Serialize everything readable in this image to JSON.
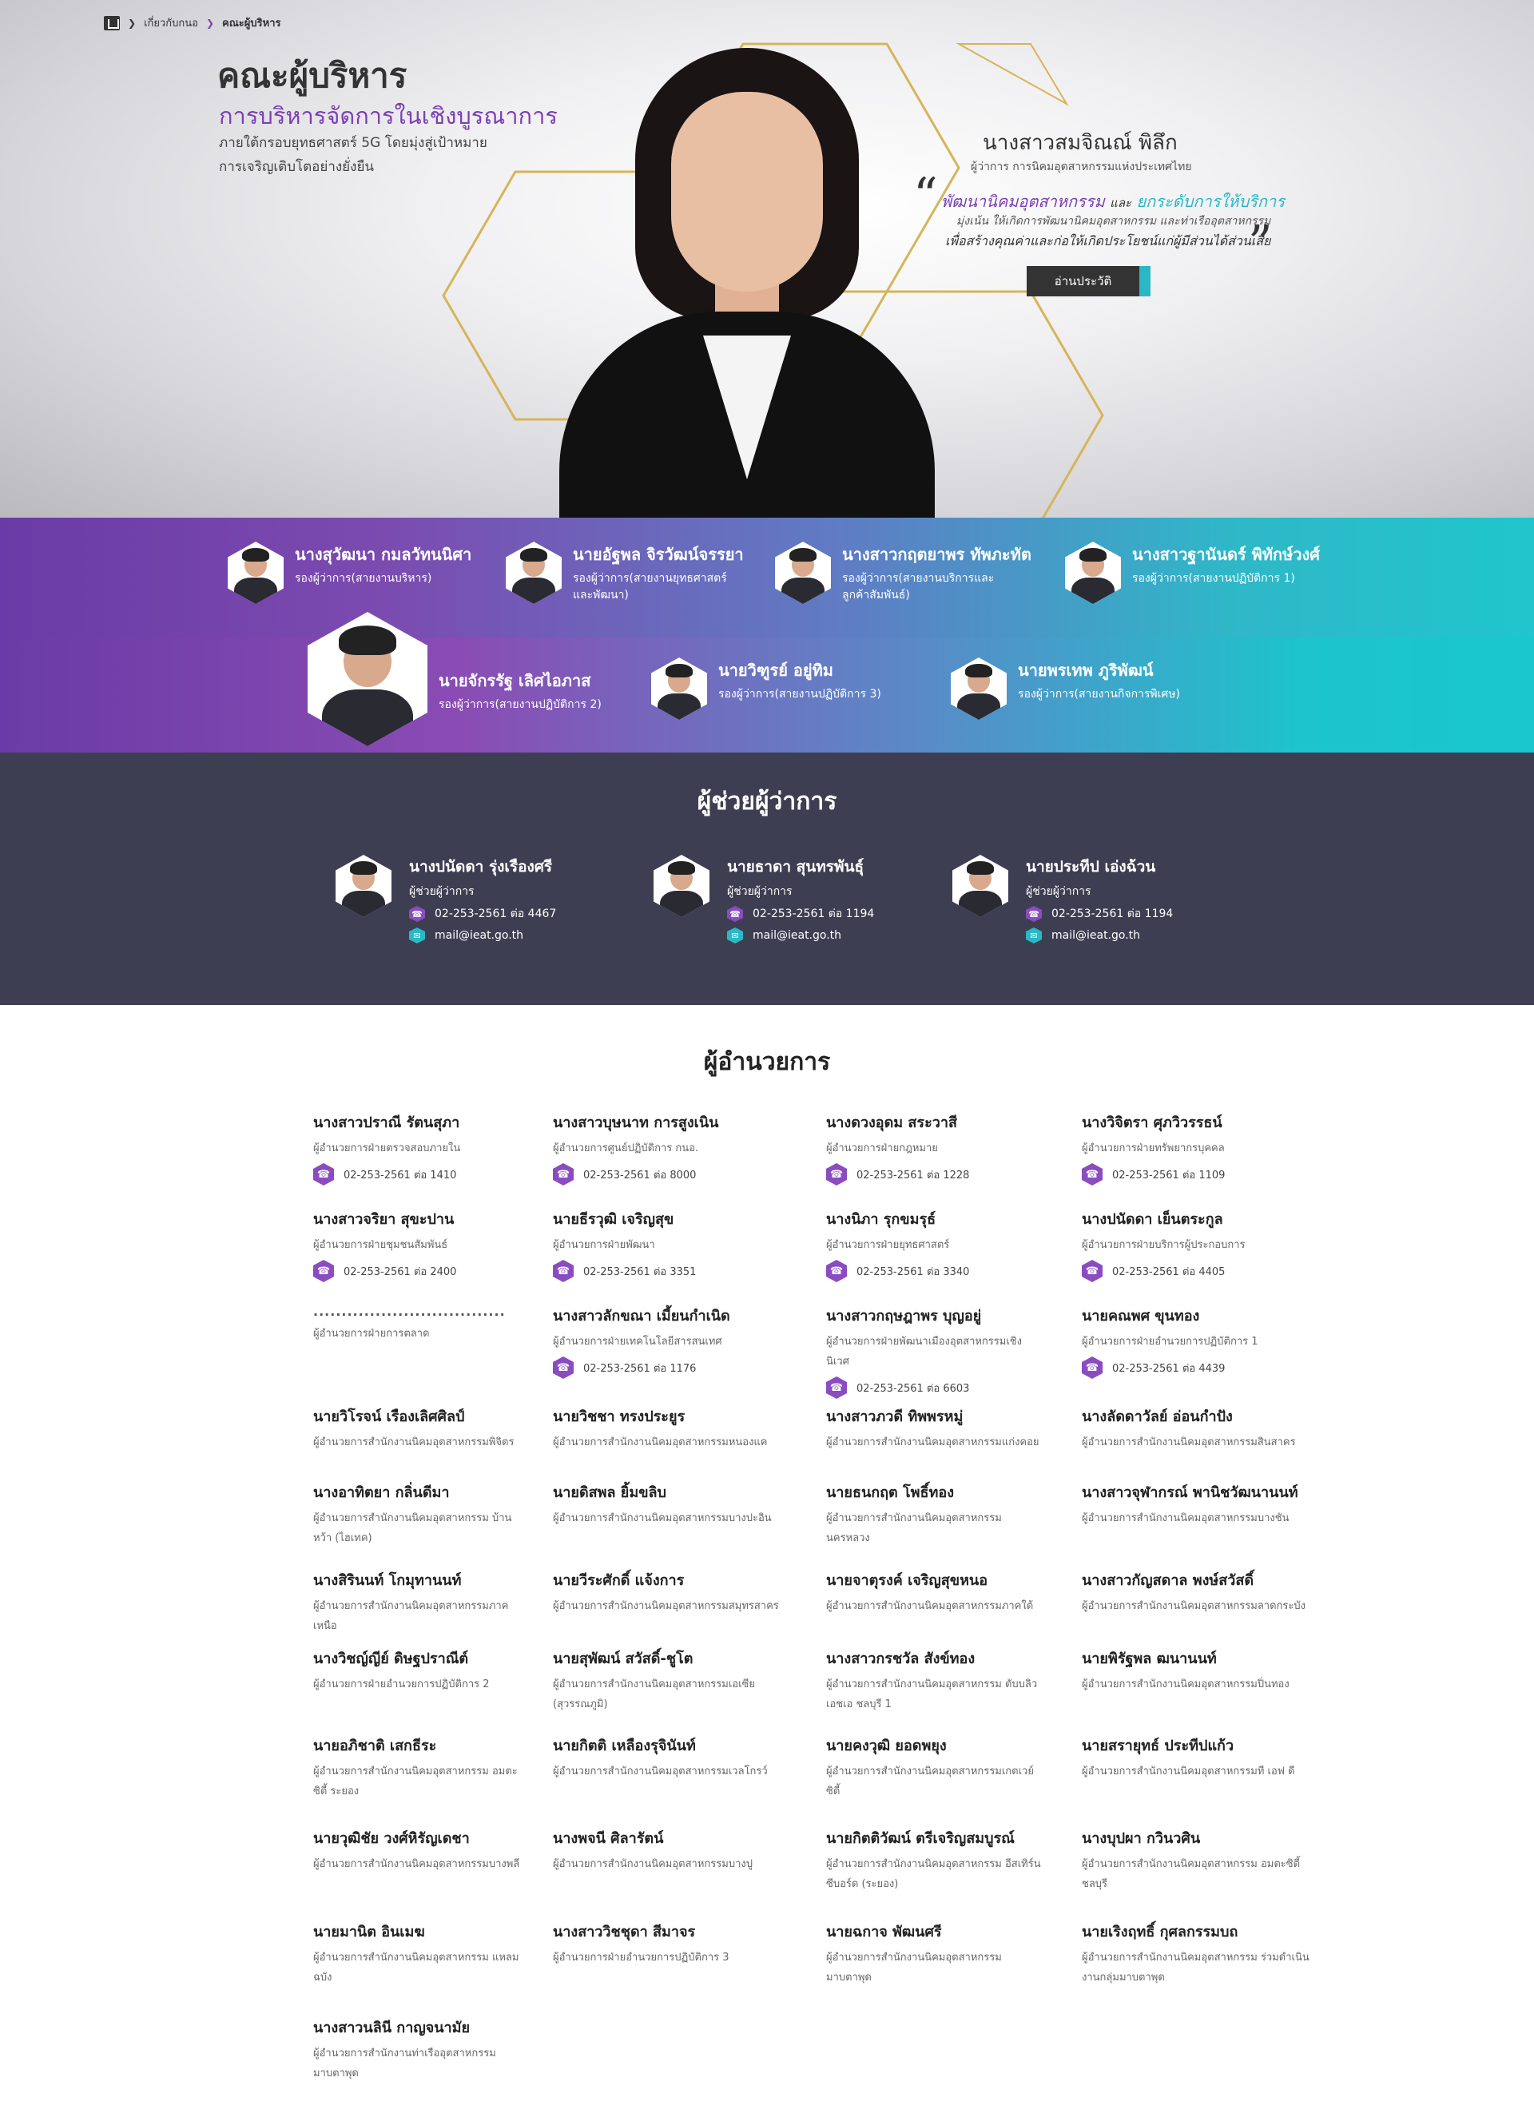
{
  "breadcrumb": {
    "parent": "เกี่ยวกับกนอ",
    "current": "คณะผู้บริหาร"
  },
  "hero": {
    "title": "คณะผู้บริหาร",
    "subtitle": "การบริหารจัดการในเชิงบูรณาการ",
    "desc_line1": "ภายใต้กรอบยุทธศาสตร์ 5G โดยมุ่งสู่เป้าหมาย",
    "desc_line2": "การเจริญเติบโตอย่างยั่งยืน"
  },
  "governor": {
    "name": "นางสาวสมจิณณ์ พิลึก",
    "title": "ผู้ว่าการ การนิคมอุตสาหกรรมแห่งประเทศไทย",
    "slogan_a": "พัฒนานิคมอุตสาหกรรม",
    "slogan_and": "และ",
    "slogan_b": "ยกระดับการให้บริการ",
    "slogan_line2": "มุ่งเน้น ให้เกิดการพัฒนานิคมอุตสาหกรรม และท่าเรืออุตสาหกรรม",
    "slogan_line3": "เพื่อสร้างคุณค่าและก่อให้เกิดประโยชน์แก่ผู้มีส่วนได้ส่วนเสีย",
    "bio_button": "อ่านประวัติ"
  },
  "deputies": [
    {
      "name": "นางสุวัฒนา กมลวัทนนิศา",
      "role": "รองผู้ว่าการ(สายงานบริหาร)"
    },
    {
      "name": "นายอัฐพล จิรวัฒน์จรรยา",
      "role": "รองผู้ว่าการ(สายงานยุทธศาสตร์ และพัฒนา)"
    },
    {
      "name": "นางสาวกฤตยาพร ทัพภะทัต",
      "role": "รองผู้ว่าการ(สายงานบริการและ ลูกค้าสัมพันธ์)"
    },
    {
      "name": "นางสาวฐานันดร์ พิทักษ์วงศ์",
      "role": "รองผู้ว่าการ(สายงานปฏิบัติการ 1)"
    },
    {
      "name": "นายจักรรัฐ เลิศไอภาส",
      "role": "รองผู้ว่าการ(สายงานปฏิบัติการ 2)"
    },
    {
      "name": "นายวิฑูรย์ อยู่ทิม",
      "role": "รองผู้ว่าการ(สายงานปฏิบัติการ 3)"
    },
    {
      "name": "นายพรเทพ ภูริพัฒน์",
      "role": "รองผู้ว่าการ(สายงานกิจการพิเศษ)"
    }
  ],
  "assistants": {
    "title": "ผู้ช่วยผู้ว่าการ",
    "items": [
      {
        "name": "นางปนัดดา รุ่งเรืองศรี",
        "role": "ผู้ช่วยผู้ว่าการ",
        "phone": "02-253-2561 ต่อ 4467",
        "email": "mail@ieat.go.th"
      },
      {
        "name": "นายธาดา สุนทรพันธุ์",
        "role": "ผู้ช่วยผู้ว่าการ",
        "phone": "02-253-2561 ต่อ 1194",
        "email": "mail@ieat.go.th"
      },
      {
        "name": "นายประทีป เอ่งฉ้วน",
        "role": "ผู้ช่วยผู้ว่าการ",
        "phone": "02-253-2561 ต่อ 1194",
        "email": "mail@ieat.go.th"
      }
    ]
  },
  "directors": {
    "title": "ผู้อำนวยการ",
    "items": [
      {
        "name": "นางสาวปราณี รัตนสุภา",
        "role": "ผู้อำนวยการฝ่ายตรวจสอบภายใน",
        "phone": "02-253-2561 ต่อ 1410"
      },
      {
        "name": "นางสาวบุษนาท การสูงเนิน",
        "role": "ผู้อำนวยการศูนย์ปฏิบัติการ กนอ.",
        "phone": "02-253-2561 ต่อ 8000"
      },
      {
        "name": "นางดวงอุดม สระวาสี",
        "role": "ผู้อำนวยการฝ่ายกฎหมาย",
        "phone": "02-253-2561 ต่อ 1228"
      },
      {
        "name": "นางวิจิตรา ศุภวิวรรธน์",
        "role": "ผู้อำนวยการฝ่ายทรัพยากรบุคคล",
        "phone": "02-253-2561 ต่อ 1109"
      },
      {
        "name": "นางสาวจริยา สุขะปาน",
        "role": "ผู้อำนวยการฝ่ายชุมชนสัมพันธ์",
        "phone": "02-253-2561 ต่อ 2400"
      },
      {
        "name": "นายธีรวุฒิ เจริญสุข",
        "role": "ผู้อำนวยการฝ่ายพัฒนา",
        "phone": "02-253-2561 ต่อ 3351"
      },
      {
        "name": "นางนิภา รุกขมรุธ์",
        "role": "ผู้อำนวยการฝ่ายยุทธศาสตร์",
        "phone": "02-253-2561 ต่อ 3340"
      },
      {
        "name": "นางปนัดดา เย็นตระกูล",
        "role": "ผู้อำนวยการฝ่ายบริการผู้ประกอบการ",
        "phone": "02-253-2561 ต่อ 4405"
      },
      {
        "name": "..................................",
        "role": "ผู้อำนวยการฝ่ายการตลาด",
        "phone": ""
      },
      {
        "name": "นางสาวลักขณา เมี้ยนกำเนิด",
        "role": "ผู้อำนวยการฝ่ายเทคโนโลยีสารสนเทศ",
        "phone": "02-253-2561 ต่อ 1176"
      },
      {
        "name": "นางสาวกฤษฎาพร บุญอยู่",
        "role": "ผู้อำนวยการฝ่ายพัฒนาเมืองอุตสาหกรรมเชิงนิเวศ",
        "phone": "02-253-2561 ต่อ 6603"
      },
      {
        "name": "นายคณพศ ขุนทอง",
        "role": "ผู้อำนวยการฝ่ายอำนวยการปฏิบัติการ 1",
        "phone": "02-253-2561 ต่อ 4439"
      },
      {
        "name": "นายวิโรจน์ เรืองเลิศศิลป์",
        "role": "ผู้อำนวยการสำนักงานนิคมอุตสาหกรรมพิจิตร",
        "phone": ""
      },
      {
        "name": "นายวิชชา ทรงประยูร",
        "role": "ผู้อำนวยการสำนักงานนิคมอุตสาหกรรมหนองแค",
        "phone": ""
      },
      {
        "name": "นางสาวภวดี ทิพพรหมู่",
        "role": "ผู้อำนวยการสำนักงานนิคมอุตสาหกรรมแก่งคอย",
        "phone": ""
      },
      {
        "name": "นางลัดดาวัลย์ อ่อนกำปัง",
        "role": "ผู้อำนวยการสำนักงานนิคมอุตสาหกรรมสินสาคร",
        "phone": ""
      },
      {
        "name": "นางอาทิตยา กลิ่นดีมา",
        "role": "ผู้อำนวยการสำนักงานนิคมอุตสาหกรรม บ้านหว้า (ไฮเทค)",
        "phone": ""
      },
      {
        "name": "นายดิสพล ยิ้มขลิบ",
        "role": "ผู้อำนวยการสำนักงานนิคมอุตสาหกรรมบางปะอิน",
        "phone": ""
      },
      {
        "name": "นายธนกฤต โพธิ์ทอง",
        "role": "ผู้อำนวยการสำนักงานนิคมอุตสาหกรรมนครหลวง",
        "phone": ""
      },
      {
        "name": "นางสาวจุฬากรณ์ พานิชวัฒนานนท์",
        "role": "ผู้อำนวยการสำนักงานนิคมอุตสาหกรรมบางชัน",
        "phone": ""
      },
      {
        "name": "นางสิรินนท์ โกมุทานนท์",
        "role": "ผู้อำนวยการสำนักงานนิคมอุตสาหกรรมภาคเหนือ",
        "phone": ""
      },
      {
        "name": "นายวีระศักดิ์ แจ้งการ",
        "role": "ผู้อำนวยการสำนักงานนิคมอุตสาหกรรมสมุทรสาคร",
        "phone": ""
      },
      {
        "name": "นายจาตุรงค์ เจริญสุขหนอ",
        "role": "ผู้อำนวยการสำนักงานนิคมอุตสาหกรรมภาคใต้",
        "phone": ""
      },
      {
        "name": "นางสาวกัญสดาล พงษ์สวัสดิ์",
        "role": "ผู้อำนวยการสำนักงานนิคมอุตสาหกรรมลาดกระบัง",
        "phone": ""
      },
      {
        "name": "นางวิชญ์ญีย์ ดิษฐปราณีต์",
        "role": "ผู้อำนวยการฝ่ายอำนวยการปฏิบัติการ 2",
        "phone": ""
      },
      {
        "name": "นายสุพัฒน์ สวัสดิ์-ชูโต",
        "role": "ผู้อำนวยการสำนักงานนิคมอุตสาหกรรมเอเซีย (สุวรรณภูมิ)",
        "phone": ""
      },
      {
        "name": "นางสาวกรชวัล สังข์ทอง",
        "role": "ผู้อำนวยการสำนักงานนิคมอุตสาหกรรม ตับบลิวเอชเอ ชลบุรี 1",
        "phone": ""
      },
      {
        "name": "นายพิรัฐพล ฒนานนท์",
        "role": "ผู้อำนวยการสำนักงานนิคมอุตสาหกรรมปิ่นทอง",
        "phone": ""
      },
      {
        "name": "นายอภิชาติ เสกธีระ",
        "role": "ผู้อำนวยการสำนักงานนิคมอุตสาหกรรม อมตะซิตี้ ระยอง",
        "phone": ""
      },
      {
        "name": "นายกิตติ เหลืองรุจินันท์",
        "role": "ผู้อำนวยการสำนักงานนิคมอุตสาหกรรมเวลโกรว์",
        "phone": ""
      },
      {
        "name": "นายคงวุฒิ ยอดพยุง",
        "role": "ผู้อำนวยการสำนักงานนิคมอุตสาหกรรมเกตเวย์ซิตี้",
        "phone": ""
      },
      {
        "name": "นายสรายุทธ์ ประทีปแก้ว",
        "role": "ผู้อำนวยการสำนักงานนิคมอุตสาหกรรมที เอฟ ดี",
        "phone": ""
      },
      {
        "name": "นายวุฒิชัย วงศ์หิรัญเดชา",
        "role": "ผู้อำนวยการสำนักงานนิคมอุตสาหกรรมบางพลี",
        "phone": ""
      },
      {
        "name": "นางพจนี ศิลารัตน์",
        "role": "ผู้อำนวยการสำนักงานนิคมอุตสาหกรรมบางปู",
        "phone": ""
      },
      {
        "name": "นายกิตติวัฒน์ ตรีเจริญสมบูรณ์",
        "role": "ผู้อำนวยการสำนักงานนิคมอุตสาหกรรม อีสเทิร์นซีบอร์ด (ระยอง)",
        "phone": ""
      },
      {
        "name": "นางบุปผา กวินวศิน",
        "role": "ผู้อำนวยการสำนักงานนิคมอุตสาหกรรม อมตะซิตี้ ชลบุรี",
        "phone": ""
      },
      {
        "name": "นายมานิต อินเมฆ",
        "role": "ผู้อำนวยการสำนักงานนิคมอุตสาหกรรม แหลมฉบัง",
        "phone": ""
      },
      {
        "name": "นางสาววิชชุดา สีมาจร",
        "role": "ผู้อำนวยการฝ่ายอำนวยการปฏิบัติการ 3",
        "phone": ""
      },
      {
        "name": "นายฉกาจ พัฒนศรี",
        "role": "ผู้อำนวยการสำนักงานนิคมอุตสาหกรรม มาบตาพุด",
        "phone": ""
      },
      {
        "name": "นายเริงฤทธิ์ กุศลกรรมบถ",
        "role": "ผู้อำนวยการสำนักงานนิคมอุตสาหกรรม ร่วมดำเนินงานกลุ่มมาบตาพุด",
        "phone": ""
      },
      {
        "name": "นางสาวนลินี กาญจนามัย",
        "role": "ผู้อำนวยการสำนักงานท่าเรืออุตสาหกรรม มาบตาพุด",
        "phone": ""
      }
    ]
  }
}
